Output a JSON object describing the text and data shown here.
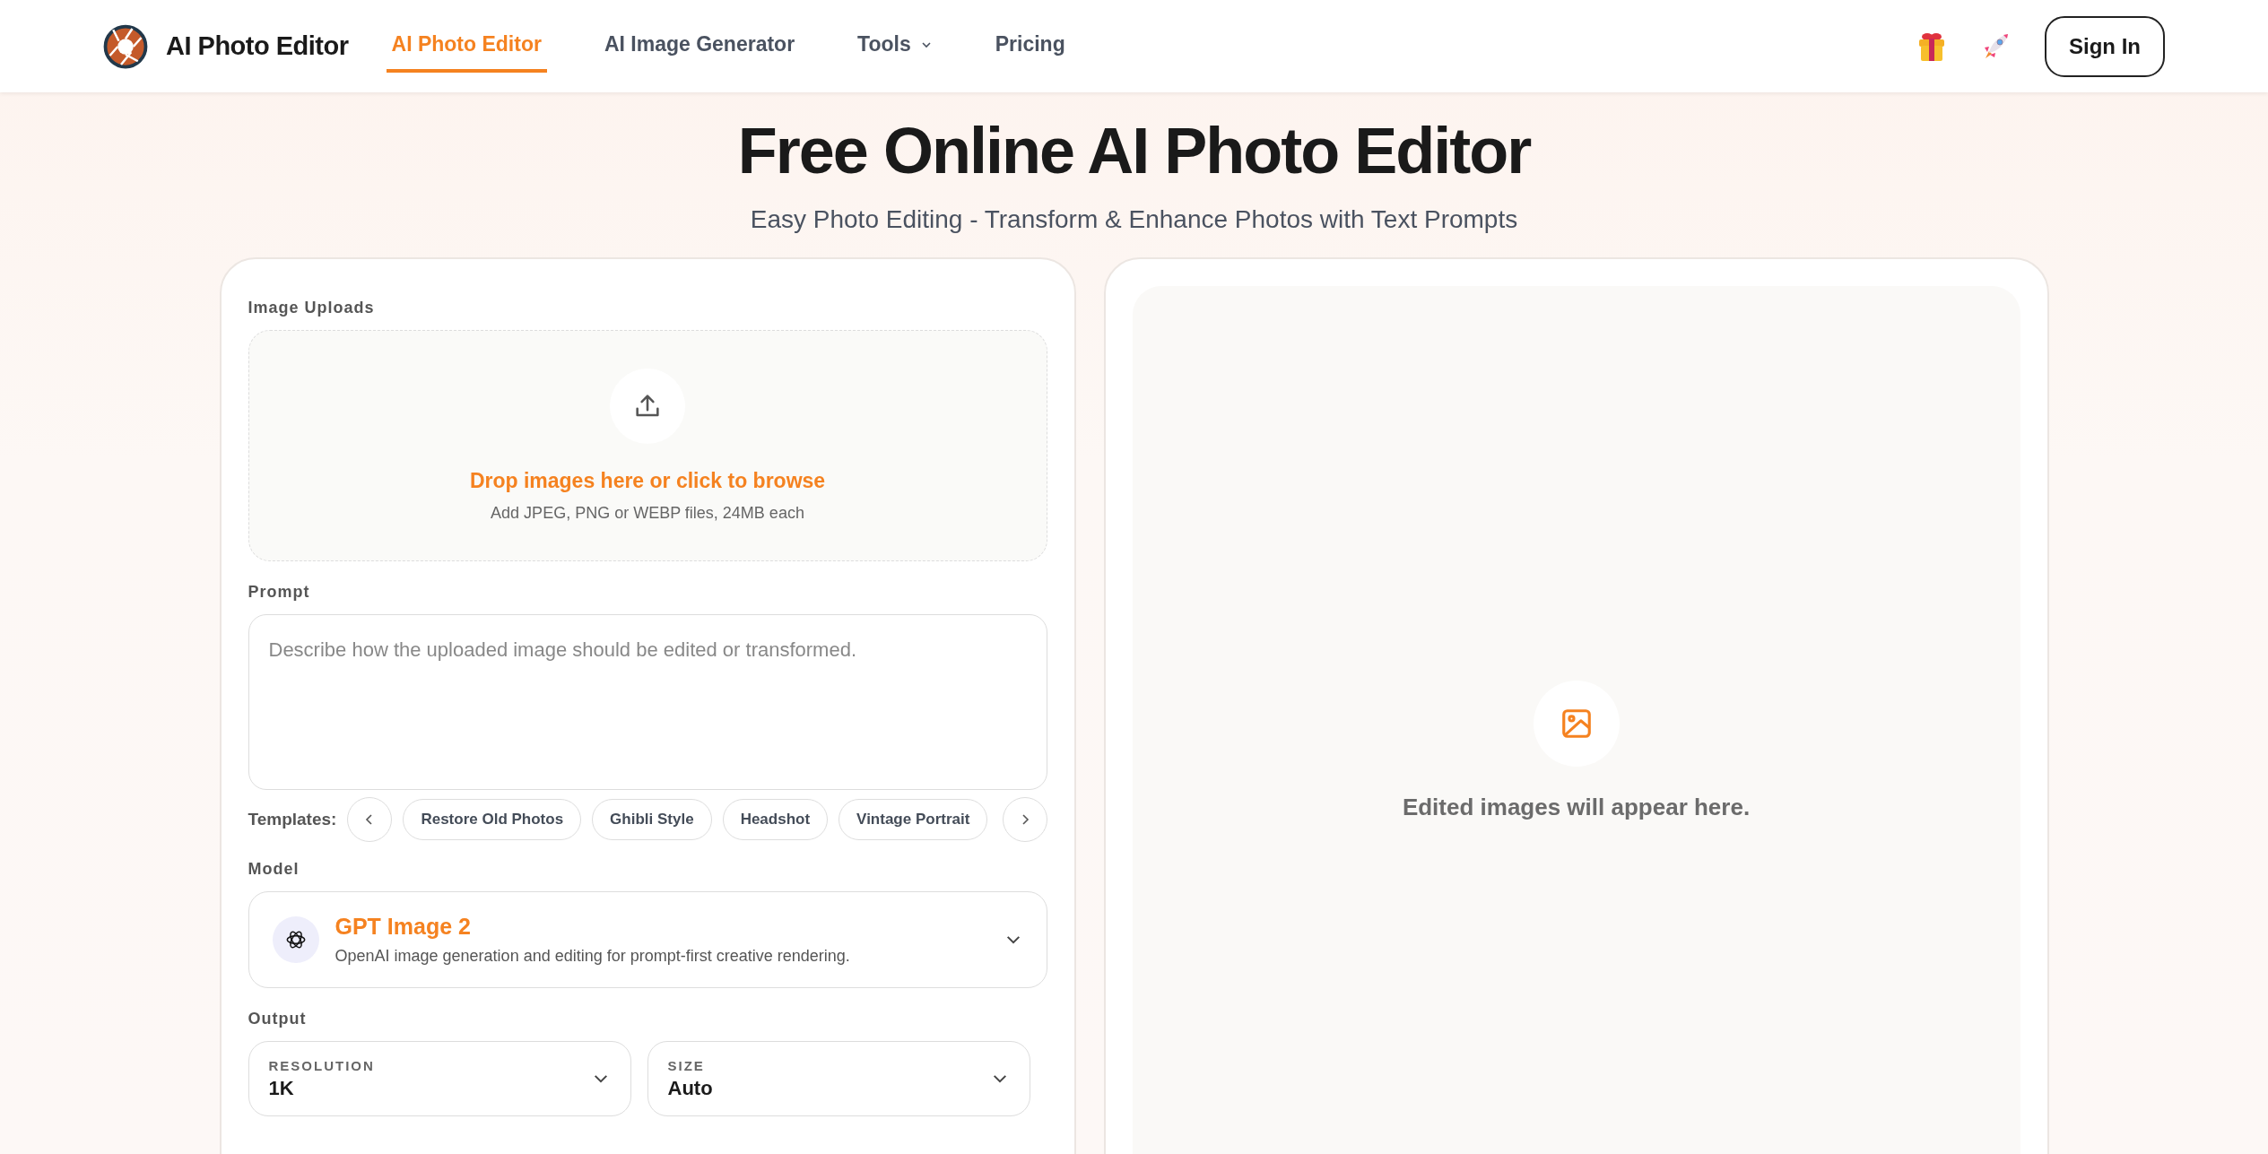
{
  "header": {
    "brand": "AI Photo Editor",
    "nav": [
      {
        "label": "AI Photo Editor",
        "selected": true,
        "dropdown": false
      },
      {
        "label": "AI Image Generator",
        "selected": false,
        "dropdown": false
      },
      {
        "label": "Tools",
        "selected": false,
        "dropdown": true
      },
      {
        "label": "Pricing",
        "selected": false,
        "dropdown": false
      }
    ],
    "sign_in": "Sign In"
  },
  "hero": {
    "title": "Free Online AI Photo Editor",
    "subtitle": "Easy Photo Editing - Transform & Enhance Photos with Text Prompts"
  },
  "form": {
    "uploads_label": "Image Uploads",
    "drop_text": "Drop images here or click to browse",
    "drop_hint": "Add JPEG, PNG or WEBP files, 24MB each",
    "prompt_label": "Prompt",
    "prompt": {
      "placeholder": "Describe how the uploaded image should be edited or transformed."
    },
    "templates_label": "Templates:",
    "templates": [
      "Restore Old Photos",
      "Ghibli Style",
      "Headshot",
      "Vintage Portrait"
    ],
    "model_label": "Model",
    "model": {
      "name": "GPT Image 2",
      "description": "OpenAI image generation and editing for prompt-first creative rendering."
    },
    "output_label": "Output",
    "outputs": [
      {
        "label": "RESOLUTION",
        "value": "1K"
      },
      {
        "label": "SIZE",
        "value": "Auto"
      }
    ]
  },
  "preview": {
    "empty_text": "Edited images will appear here."
  }
}
